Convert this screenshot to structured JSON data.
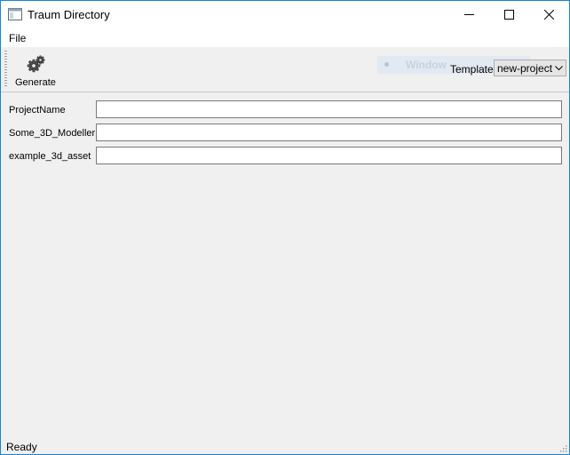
{
  "window": {
    "title": "Traum Directory",
    "icons": {
      "app": "window-app-icon",
      "minimize": "minimize-icon",
      "maximize": "maximize-icon",
      "close": "close-icon"
    }
  },
  "menu": {
    "items": [
      "File"
    ]
  },
  "toolbar": {
    "generate_label": "Generate",
    "generate_icon": "gear-icon",
    "ghost_text": "Window",
    "template_label": "Template:",
    "template_value": "new-project"
  },
  "form": {
    "fields": [
      {
        "label": "ProjectName",
        "value": ""
      },
      {
        "label": "Some_3D_Modeller",
        "value": ""
      },
      {
        "label": "example_3d_asset",
        "value": ""
      }
    ]
  },
  "status": {
    "text": "Ready"
  },
  "colors": {
    "window_border": "#1883d7",
    "background": "#f0f0f0",
    "titlebar": "#ffffff"
  }
}
